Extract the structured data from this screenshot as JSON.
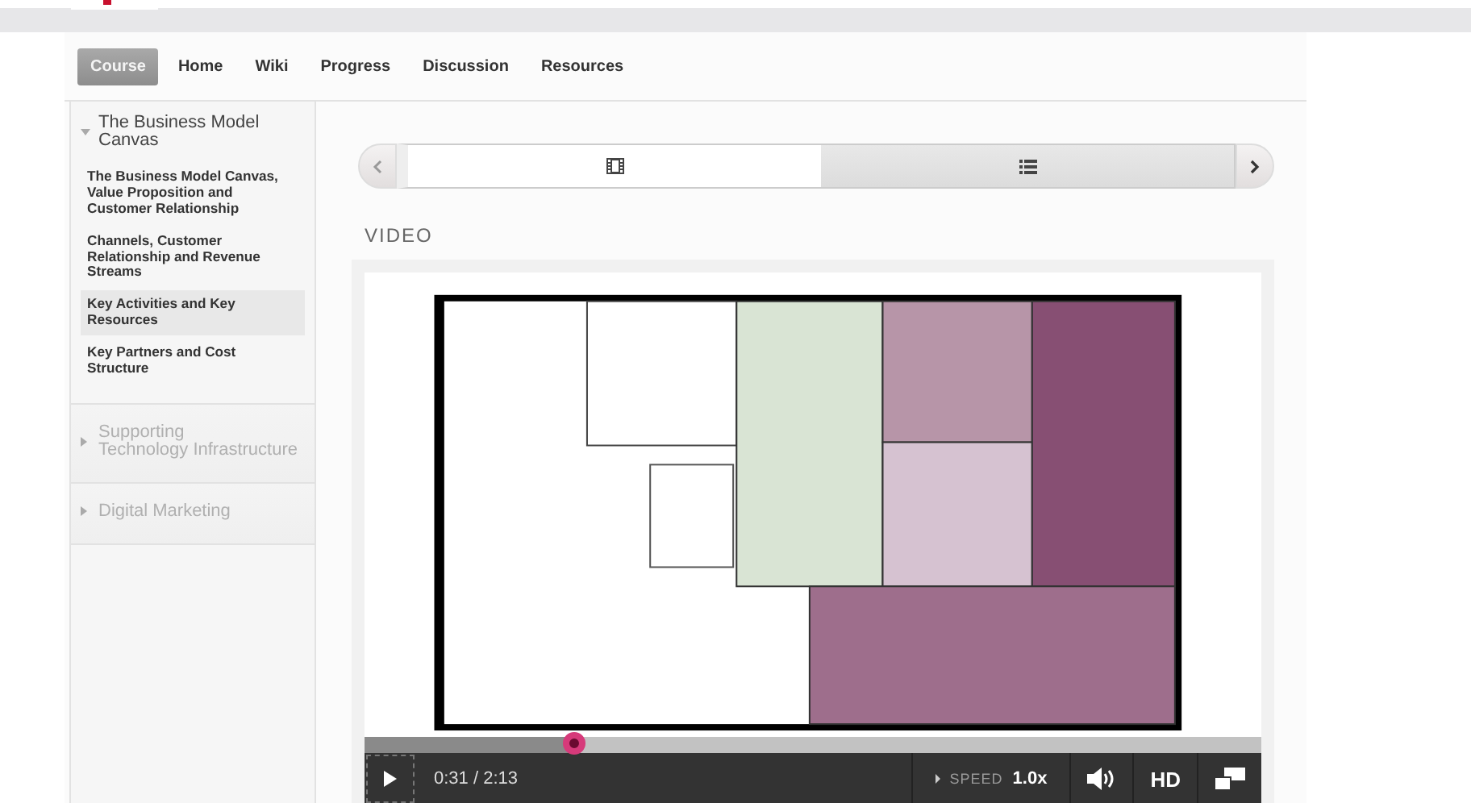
{
  "nav_tabs": [
    {
      "label": "Course",
      "selected": true
    },
    {
      "label": "Home",
      "selected": false
    },
    {
      "label": "Wiki",
      "selected": false
    },
    {
      "label": "Progress",
      "selected": false
    },
    {
      "label": "Discussion",
      "selected": false
    },
    {
      "label": "Resources",
      "selected": false
    }
  ],
  "sidebar": {
    "sections": [
      {
        "title": "The Business Model Canvas",
        "expanded": true,
        "items": [
          {
            "label": "The Business Model Canvas, Value Proposition and Customer Relationship",
            "selected": false
          },
          {
            "label": "Channels, Customer Relationship and Revenue Streams",
            "selected": false
          },
          {
            "label": "Key Activities and Key Resources",
            "selected": true
          },
          {
            "label": "Key Partners and Cost Structure",
            "selected": false
          }
        ]
      },
      {
        "title": "Supporting\nTechnology Infrastructure",
        "expanded": false
      },
      {
        "title": "Digital Marketing",
        "expanded": false
      }
    ]
  },
  "sequence_nav": {
    "units": [
      {
        "kind": "video",
        "selected": true
      },
      {
        "kind": "list",
        "selected": false
      }
    ]
  },
  "heading": "VIDEO",
  "player": {
    "level": 0.233,
    "time": "0:31 / 2:13",
    "speed_label": "SPEED",
    "speed": "1.0x",
    "quality": "HD"
  }
}
